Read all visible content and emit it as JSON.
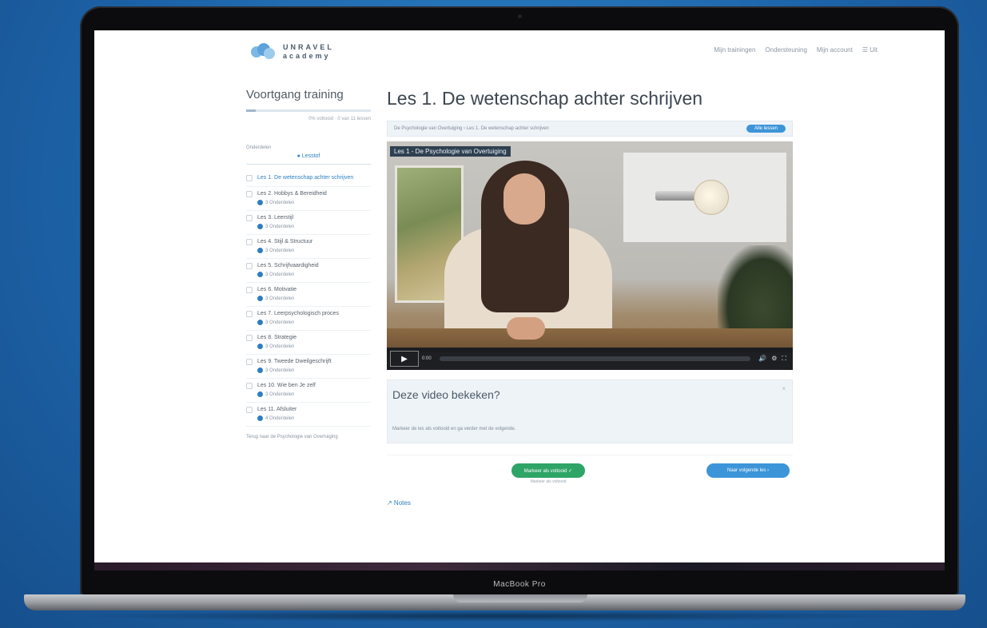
{
  "device": {
    "model_label": "MacBook Pro"
  },
  "header": {
    "logo_line1": "UNRAVEL",
    "logo_line2": "academy",
    "nav": [
      "Mijn trainingen",
      "Ondersteuning",
      "Mijn account",
      "☰ Uit"
    ]
  },
  "sidebar": {
    "title": "Voortgang training",
    "progress_text": "0% voltooid · 0 van 11 lessen",
    "progress_fraction": 0.08,
    "section_label": "Onderdelen",
    "pill_label": "Lesstof",
    "lessons": [
      {
        "title": "Les 1. De wetenschap achter schrijven",
        "meta": ""
      },
      {
        "title": "Les 2. Hobbys & Bereidheid",
        "meta": "3 Onderdelen"
      },
      {
        "title": "Les 3. Leerstijl",
        "meta": "3 Onderdelen"
      },
      {
        "title": "Les 4. Stijl & Structuur",
        "meta": "3 Onderdelen"
      },
      {
        "title": "Les 5. Schrijfvaardigheid",
        "meta": "3 Onderdelen"
      },
      {
        "title": "Les 6. Motivatie",
        "meta": "3 Onderdelen"
      },
      {
        "title": "Les 7. Leerpsychologisch proces",
        "meta": "3 Onderdelen"
      },
      {
        "title": "Les 8. Strategie",
        "meta": "3 Onderdelen"
      },
      {
        "title": "Les 9. Tweede Dweilgeschrijft",
        "meta": "3 Onderdelen"
      },
      {
        "title": "Les 10. Wie ben Je zelf",
        "meta": "3 Onderdelen"
      },
      {
        "title": "Les 11. Afsluiter",
        "meta": "4 Onderdelen"
      }
    ],
    "footer": "Terug naar de Psychologie van Overtuiging"
  },
  "main": {
    "title": "Les 1. De wetenschap achter schrijven",
    "breadcrumb": "De Psychologie van Overtuiging › Les 1. De wetenschap achter schrijven",
    "breadcrumb_button": "Alle lessen",
    "video": {
      "title": "Les 1 - De Psychologie van Overtuiging",
      "time": "0:00",
      "controls": [
        "🔊",
        "⚙",
        "⛶"
      ]
    },
    "question": {
      "heading": "Deze video bekeken?",
      "close": "×",
      "sub": "Markeer de les als voltooid en ga verder met de volgende."
    },
    "complete_button": "Markeer als voltooid ✓",
    "complete_sub": "Markeer als voltooid",
    "next_button": "Naar volgende les ›",
    "notes": "↗ Notes"
  },
  "colors": {
    "accent": "#3c95d8",
    "success": "#2ea566",
    "background": "#1d63a8"
  }
}
